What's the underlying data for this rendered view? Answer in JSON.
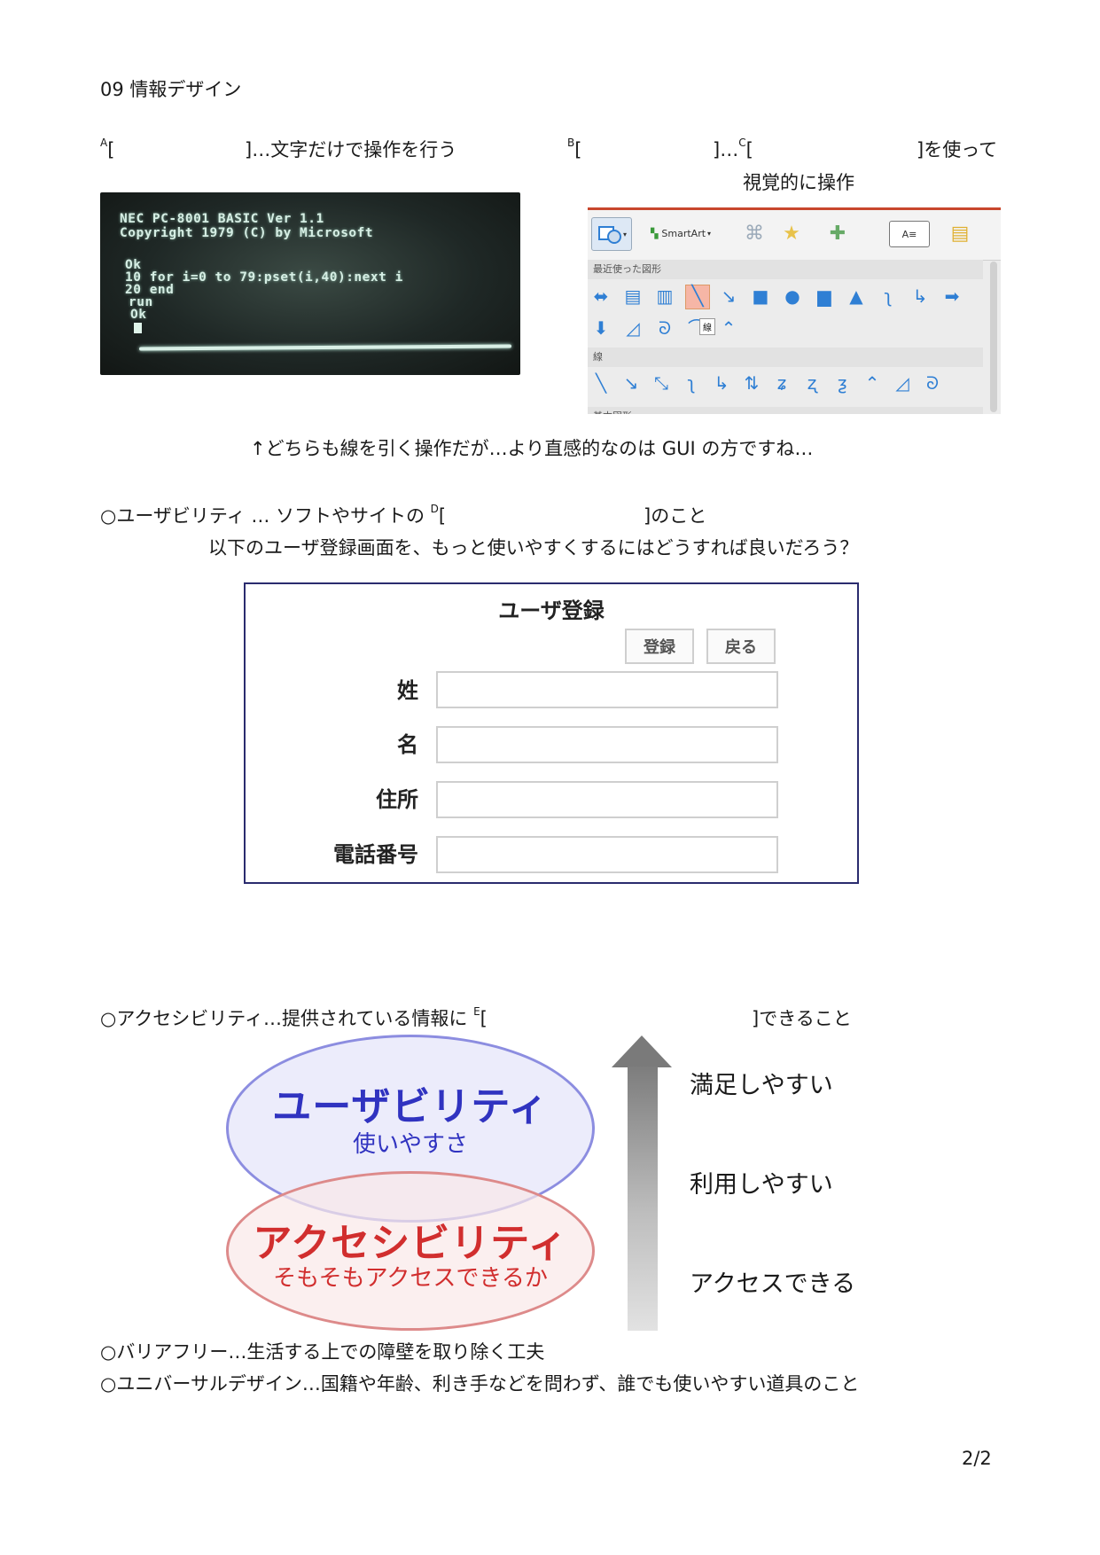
{
  "header": {
    "title": "09  情報デザイン"
  },
  "section_cui": {
    "marker_a": "A",
    "bracket_open": "[",
    "bracket_close": "]",
    "description": "…文字だけで操作を行う"
  },
  "section_gui": {
    "marker_b": "B",
    "marker_c": "C",
    "text_mid": "]…",
    "bracket_open": "[",
    "description_end": "]を使って",
    "description_line2": "視覚的に操作"
  },
  "terminal": {
    "lines": [
      "NEC PC-8001 BASIC Ver 1.1",
      "Copyright 1979 (C) by Microsoft",
      "Ok",
      "10 for i=0 to 79:pset(i,40):next i",
      "20 end",
      "run",
      "Ok"
    ]
  },
  "gui_toolbar": {
    "smartart_label": "SmartArt",
    "section_recent": "最近使った図形",
    "section_lines": "線",
    "tooltip": "線",
    "section_basic": "基本図形"
  },
  "caption": "↑どちらも線を引く操作だが…より直感的なのは GUI の方ですね…",
  "usability": {
    "prefix": "○ユーザビリティ  …  ソフトやサイトの ",
    "marker_d": "D",
    "bracket_open": "[",
    "suffix": "]のこと",
    "question": "以下のユーザ登録画面を、もっと使いやすくするにはどうすれば良いだろう？"
  },
  "form": {
    "title": "ユーザ登録",
    "register_button": "登録",
    "back_button": "戻る",
    "fields": [
      {
        "label": "姓"
      },
      {
        "label": "名"
      },
      {
        "label": "住所"
      },
      {
        "label": "電話番号"
      }
    ]
  },
  "accessibility": {
    "prefix": "○アクセシビリティ…提供されている情報に ",
    "marker_e": "E",
    "bracket_open": "[",
    "suffix": "]できること"
  },
  "diagram": {
    "usability_title": "ユーザビリティ",
    "usability_sub": "使いやすさ",
    "accessibility_title": "アクセシビリティ",
    "accessibility_sub": "そもそもアクセスできるか",
    "levels": [
      "満足しやすい",
      "利用しやすい",
      "アクセスできる"
    ],
    "colors": {
      "usability": "#3033c0",
      "accessibility": "#d12e2e"
    }
  },
  "barrier_free": "○バリアフリー…生活する上での障壁を取り除く工夫",
  "universal_design": "○ユニバーサルデザイン…国籍や年齢、利き手などを問わず、誰でも使いやすい道具のこと",
  "footer": {
    "page": "2/2"
  }
}
